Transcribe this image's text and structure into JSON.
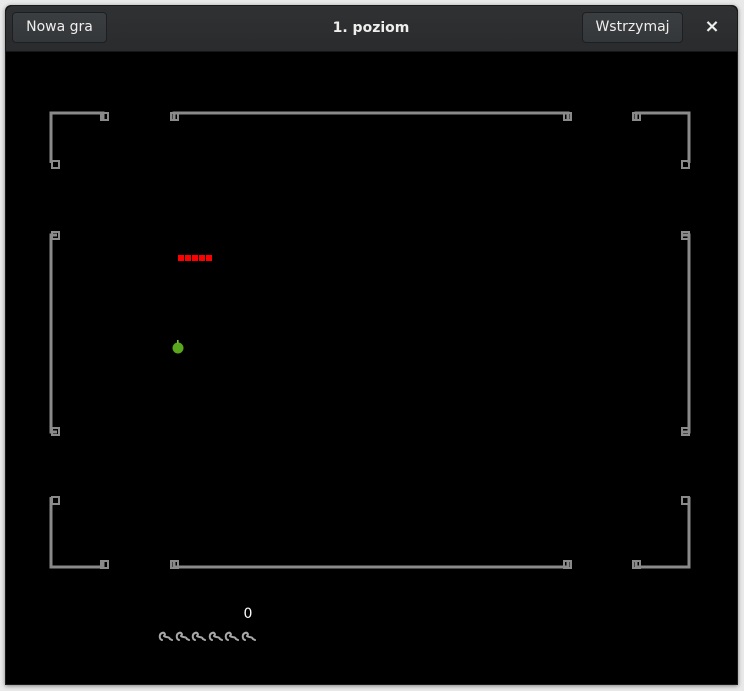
{
  "header": {
    "title": "1. poziom",
    "new_game_label": "Nowa gra",
    "pause_label": "Wstrzymaj",
    "close_glyph": "×"
  },
  "game": {
    "score": "0",
    "lives": 6,
    "colors": {
      "background": "#000000",
      "wall": "#8a8a8a",
      "snake": "#ff0000",
      "apple": "#5aa61c"
    },
    "snake_length": 5,
    "apple_icon": "apple-icon",
    "life_icon": "worm-life-icon"
  }
}
